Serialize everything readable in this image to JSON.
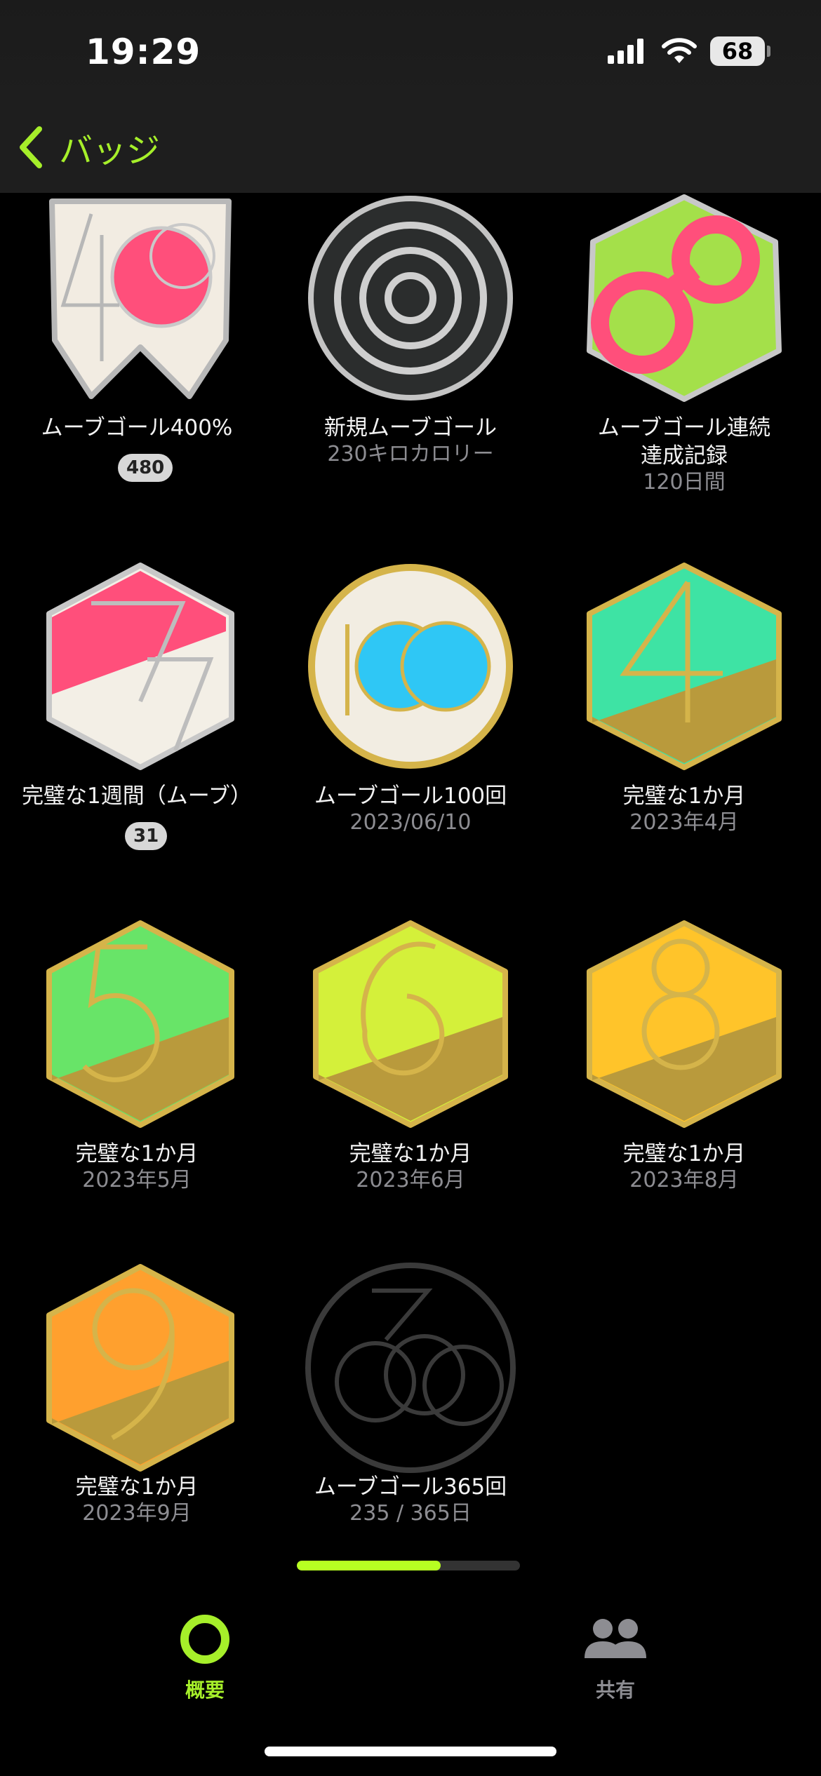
{
  "status": {
    "time": "19:29",
    "battery": "68"
  },
  "nav": {
    "back_label": "バッジ"
  },
  "badges": [
    {
      "title": "ムーブゴール400%",
      "count": "480"
    },
    {
      "title": "新規ムーブゴール",
      "subtitle": "230キロカロリー"
    },
    {
      "title": "ムーブゴール連続",
      "title2": "達成記録",
      "subtitle": "120日間"
    },
    {
      "title": "完璧な1週間（ムーブ）",
      "count": "31"
    },
    {
      "title": "ムーブゴール100回",
      "subtitle": "2023/06/10"
    },
    {
      "title": "完璧な1か月",
      "subtitle": "2023年4月"
    },
    {
      "title": "完璧な1か月",
      "subtitle": "2023年5月"
    },
    {
      "title": "完璧な1か月",
      "subtitle": "2023年6月"
    },
    {
      "title": "完璧な1か月",
      "subtitle": "2023年8月"
    },
    {
      "title": "完璧な1か月",
      "subtitle": "2023年9月"
    },
    {
      "title": "ムーブゴール365回",
      "subtitle": "235 / 365日",
      "progress": 0.644
    }
  ],
  "badge_art": {
    "b400": "400",
    "b100": "100",
    "bweek": "7",
    "b365": "365",
    "months": [
      "4",
      "5",
      "6",
      "8",
      "9"
    ],
    "year": "2023"
  },
  "tabs": [
    {
      "label": "概要",
      "icon": "activity-ring-icon",
      "active": true
    },
    {
      "label": "共有",
      "icon": "people-icon",
      "active": false
    }
  ],
  "colors": {
    "accent": "#a6ef2a",
    "move_pink": "#ff4f7b",
    "gold": "#c8a640"
  }
}
